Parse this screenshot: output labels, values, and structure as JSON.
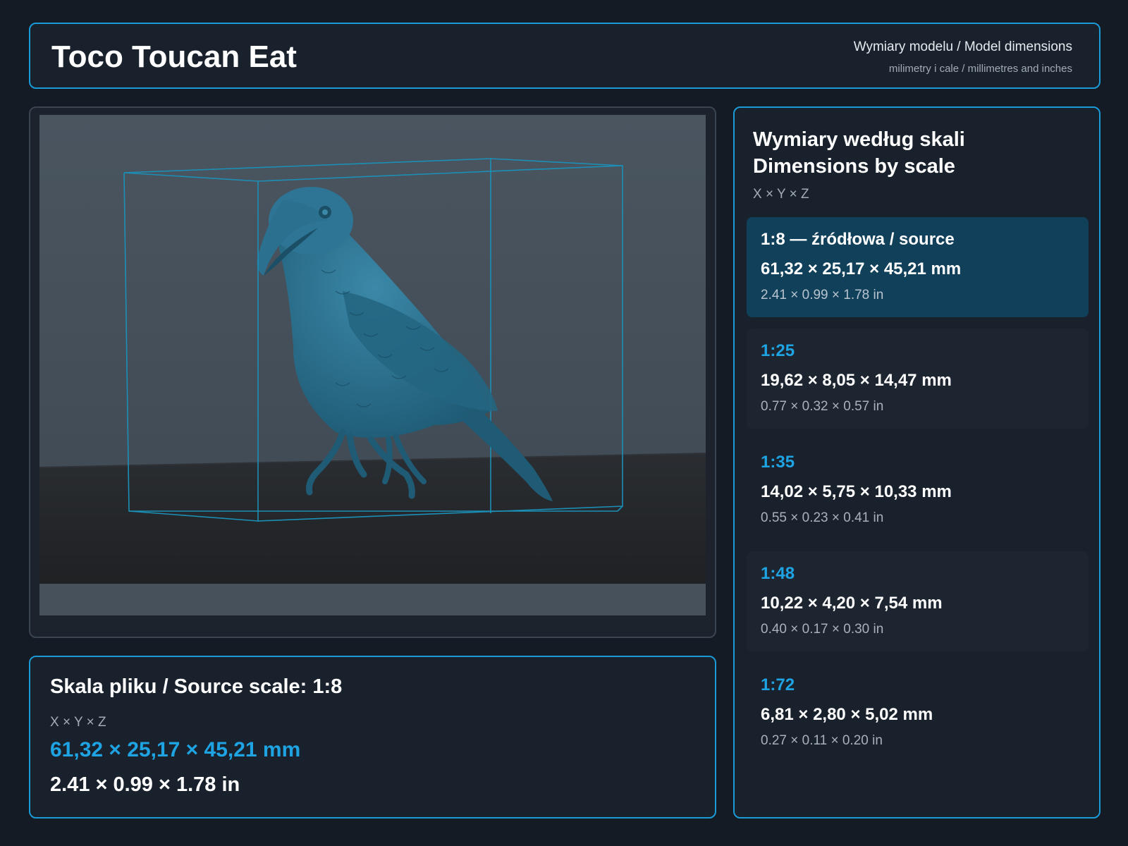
{
  "header": {
    "title": "Toco Toucan Eat",
    "subtitle": "Wymiary modelu / Model dimensions",
    "units_note": "milimetry i cale / millimetres and inches"
  },
  "source": {
    "label": "Skala pliku / Source scale: 1:8",
    "axes": "X × Y × Z",
    "mm": "61,32 × 25,17 × 45,21 mm",
    "inch": "2.41 × 0.99 × 1.78 in"
  },
  "scales_panel": {
    "title_pl": "Wymiary według skali",
    "title_en": "Dimensions by scale",
    "axes": "X × Y × Z",
    "items": [
      {
        "ratio": "1:8  —  źródłowa / source",
        "mm": "61,32 × 25,17 × 45,21 mm",
        "inch": "2.41 × 0.99 × 1.78 in"
      },
      {
        "ratio": "1:25",
        "mm": "19,62 × 8,05 × 14,47 mm",
        "inch": "0.77 × 0.32 × 0.57 in"
      },
      {
        "ratio": "1:35",
        "mm": "14,02 × 5,75 × 10,33 mm",
        "inch": "0.55 × 0.23 × 0.41 in"
      },
      {
        "ratio": "1:48",
        "mm": "10,22 × 4,20 × 7,54 mm",
        "inch": "0.40 × 0.17 × 0.30 in"
      },
      {
        "ratio": "1:72",
        "mm": "6,81 × 2,80 × 5,02 mm",
        "inch": "0.27 × 0.11 × 0.20 in"
      }
    ]
  },
  "colors": {
    "accent": "#1a9ad6",
    "value_blue": "#1ea4e3",
    "model": "#2a6f8c",
    "background": "#141b24",
    "active_row": "#11405a"
  },
  "icons": {
    "model": "toucan-model-render",
    "bounding_box": "bounding-box-wireframe"
  }
}
